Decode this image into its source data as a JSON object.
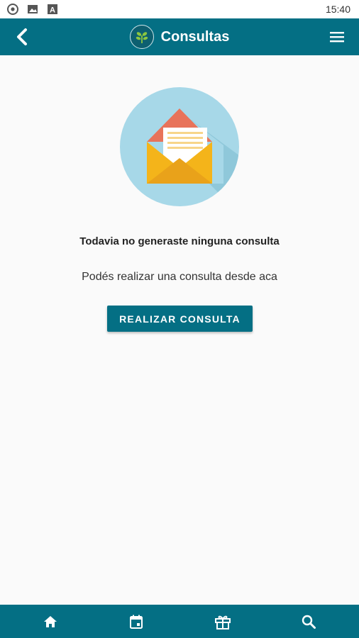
{
  "statusbar": {
    "time": "15:40",
    "icons": [
      "chrome-icon",
      "image-icon",
      "font-a-icon"
    ]
  },
  "appbar": {
    "title": "Consultas",
    "back_icon": "back-chevron-icon",
    "logo_icon": "leaf-logo-icon",
    "menu_icon": "hamburger-menu-icon"
  },
  "empty_state": {
    "illustration": "open-envelope-icon",
    "heading": "Todavia no generaste ninguna consulta",
    "subtext": "Podés realizar una consulta desde aca",
    "button_label": "REALIZAR CONSULTA"
  },
  "bottom_nav": [
    {
      "icon": "home-icon"
    },
    {
      "icon": "calendar-icon"
    },
    {
      "icon": "gift-icon"
    },
    {
      "icon": "search-icon"
    }
  ],
  "colors": {
    "primary": "#046f84",
    "background": "#fafafa",
    "envelope": "#f4b41a",
    "letter_flap": "#e8735a",
    "circle": "#a7d8e8"
  }
}
